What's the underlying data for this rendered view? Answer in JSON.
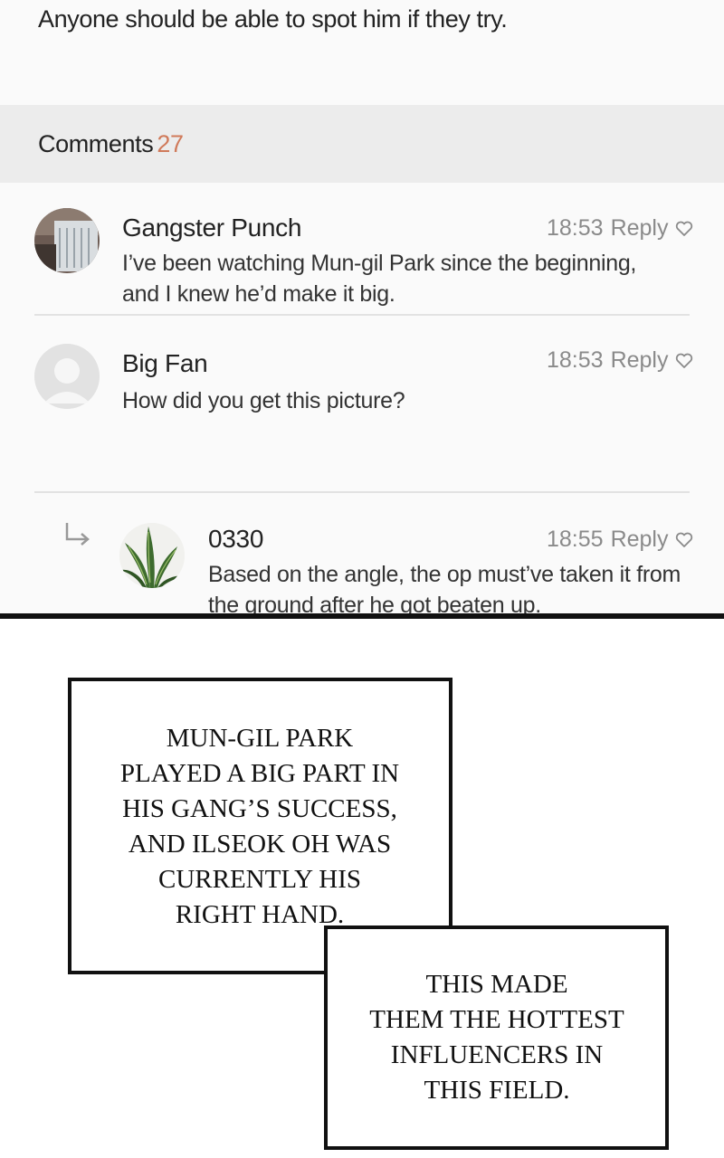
{
  "post": {
    "text": "Anyone should be able to spot him if they try."
  },
  "comments_header": {
    "label": "Comments",
    "count": "27"
  },
  "comments": [
    {
      "name": "Gangster Punch",
      "time": "18:53",
      "reply": "Reply",
      "line1": "I’ve been watching Mun-gil Park since the beginning,",
      "line2": "and I knew he’d make it big."
    },
    {
      "name": "Big Fan",
      "time": "18:53",
      "reply": "Reply",
      "line1": "How did you get this picture?"
    },
    {
      "name": "0330",
      "time": "18:55",
      "reply": "Reply",
      "line1": "Based on the angle, the op must’ve taken it from",
      "line2": "the ground after he got beaten up."
    }
  ],
  "captions": {
    "box1": "MUN-GIL PARK\nPLAYED A BIG PART IN\nHIS GANG’S SUCCESS,\nAND ILSEOK OH WAS\nCURRENTLY HIS\nRIGHT HAND.",
    "box2": "THIS MADE\nTHEM THE HOTTEST\nINFLUENCERS IN\nTHIS FIELD."
  },
  "icons": {
    "heart": "heart-outline-icon",
    "reply_arrow": "reply-arrow-icon",
    "default_avatar": "default-avatar-icon"
  },
  "colors": {
    "count_accent": "#d07a5a",
    "header_bg": "#ececec",
    "meta_gray": "#8a8a8a"
  }
}
